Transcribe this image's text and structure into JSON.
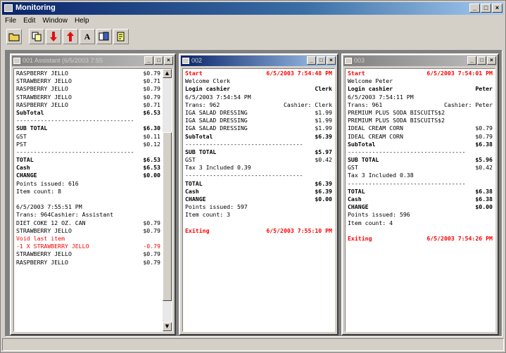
{
  "app": {
    "title": "Monitoring",
    "min": "_",
    "max": "□",
    "close": "×"
  },
  "menu": [
    "File",
    "Edit",
    "Window",
    "Help"
  ],
  "toolbar": [
    {
      "name": "open-folder-icon",
      "glyph": "▭"
    },
    {
      "name": "copy-icon",
      "glyph": "❐"
    },
    {
      "name": "arrow-down-icon",
      "glyph": "↓"
    },
    {
      "name": "arrow-up-icon",
      "glyph": "↑"
    },
    {
      "name": "font-icon",
      "glyph": "A"
    },
    {
      "name": "documents-icon",
      "glyph": "▤"
    },
    {
      "name": "help-icon",
      "glyph": "⎍"
    }
  ],
  "windows": [
    {
      "title": "001 Assistant (6/5/2003 7:55",
      "lines": [
        {
          "l": "RASPBERRY JELLO",
          "r": "$0.79"
        },
        {
          "l": "STRAWBERRY JELLO",
          "r": "$0.71"
        },
        {
          "l": "RASPBERRY JELLO",
          "r": "$0.79"
        },
        {
          "l": "STRAWBERRY JELLO",
          "r": "$0.79"
        },
        {
          "l": "RASPBERRY JELLO",
          "r": "$0.71"
        },
        {
          "l": "SubTotal",
          "r": "$6.53",
          "s": "bold"
        },
        {
          "l": "----------------------------------",
          "r": ""
        },
        {
          "l": "SUB TOTAL",
          "r": "$6.30",
          "s": "bold"
        },
        {
          "l": "GST",
          "r": "$0.11"
        },
        {
          "l": "PST",
          "r": "$0.12"
        },
        {
          "l": "----------------------------------",
          "r": ""
        },
        {
          "l": "TOTAL",
          "r": "$6.53",
          "s": "bold"
        },
        {
          "l": "Cash",
          "r": "$6.53",
          "s": "bold"
        },
        {
          "l": "CHANGE",
          "r": "$0.00",
          "s": "bold"
        },
        {
          "l": "Points issued: 616",
          "r": ""
        },
        {
          "l": "Item count: 8",
          "r": ""
        },
        {
          "l": "",
          "r": ""
        },
        {
          "l": "6/5/2003 7:55:51 PM",
          "r": ""
        },
        {
          "l": "Trans: 964Cashier: Assistant",
          "r": ""
        },
        {
          "l": "DIET COKE 12 OZ. CAN",
          "r": "$0.79"
        },
        {
          "l": "STRAWBERRY JELLO",
          "r": "$0.79"
        },
        {
          "l": "Void last item",
          "r": "",
          "s": "redplain"
        },
        {
          "l": "-1 X STRAWBERRY JELLO",
          "r": "-0.79",
          "s": "redplain"
        },
        {
          "l": "STRAWBERRY JELLO",
          "r": "$0.79"
        },
        {
          "l": "RASPBERRY JELLO",
          "r": "$0.79"
        }
      ]
    },
    {
      "title": "002",
      "lines": [
        {
          "l": "Start",
          "r": "6/5/2003 7:54:48 PM",
          "s": "red"
        },
        {
          "l": "Welcome Clerk",
          "r": ""
        },
        {
          "l": "Login cashier",
          "r": "Clerk",
          "s": "bold"
        },
        {
          "l": "6/5/2003 7:54:54 PM",
          "r": ""
        },
        {
          "l": "Trans: 962",
          "r": "Cashier: Clerk"
        },
        {
          "l": "IGA SALAD DRESSING",
          "r": "$1.99"
        },
        {
          "l": "IGA SALAD DRESSING",
          "r": "$1.99"
        },
        {
          "l": "IGA SALAD DRESSING",
          "r": "$1.99"
        },
        {
          "l": "SubTotal",
          "r": "$6.39",
          "s": "bold"
        },
        {
          "l": "----------------------------------",
          "r": ""
        },
        {
          "l": "SUB TOTAL",
          "r": "$5.97",
          "s": "bold"
        },
        {
          "l": "GST",
          "r": "$0.42"
        },
        {
          "l": "Tax 3 Included 0.39",
          "r": ""
        },
        {
          "l": "----------------------------------",
          "r": ""
        },
        {
          "l": "TOTAL",
          "r": "$6.39",
          "s": "bold"
        },
        {
          "l": "Cash",
          "r": "$6.39",
          "s": "bold"
        },
        {
          "l": "CHANGE",
          "r": "$0.00",
          "s": "bold"
        },
        {
          "l": "Points issued: 597",
          "r": ""
        },
        {
          "l": "Item count: 3",
          "r": ""
        },
        {
          "l": "",
          "r": ""
        },
        {
          "l": "Exiting",
          "r": "6/5/2003 7:55:10 PM",
          "s": "red"
        }
      ]
    },
    {
      "title": "003",
      "lines": [
        {
          "l": "Start",
          "r": "6/5/2003 7:54:01 PM",
          "s": "red"
        },
        {
          "l": "Welcome Peter",
          "r": ""
        },
        {
          "l": "Login cashier",
          "r": "Peter",
          "s": "bold"
        },
        {
          "l": "6/5/2003 7:54:11 PM",
          "r": ""
        },
        {
          "l": "Trans: 961",
          "r": "Cashier: Peter"
        },
        {
          "l": "PREMIUM PLUS SODA BISCUITS$2",
          "r": ""
        },
        {
          "l": "PREMIUM PLUS SODA BISCUITS$2",
          "r": ""
        },
        {
          "l": "IDEAL CREAM CORN",
          "r": "$0.79"
        },
        {
          "l": "IDEAL CREAM CORN",
          "r": "$0.79"
        },
        {
          "l": "SubTotal",
          "r": "$6.38",
          "s": "bold"
        },
        {
          "l": "----------------------------------",
          "r": ""
        },
        {
          "l": "SUB TOTAL",
          "r": "$5.96",
          "s": "bold"
        },
        {
          "l": "GST",
          "r": "$0.42"
        },
        {
          "l": "Tax 3 Included 0.38",
          "r": ""
        },
        {
          "l": "----------------------------------",
          "r": ""
        },
        {
          "l": "TOTAL",
          "r": "$6.38",
          "s": "bold"
        },
        {
          "l": "Cash",
          "r": "$6.38",
          "s": "bold"
        },
        {
          "l": "CHANGE",
          "r": "$0.00",
          "s": "bold"
        },
        {
          "l": "Points issued: 596",
          "r": ""
        },
        {
          "l": "Item count: 4",
          "r": ""
        },
        {
          "l": "",
          "r": ""
        },
        {
          "l": "Exiting",
          "r": "6/5/2003 7:54:26 PM",
          "s": "red"
        }
      ]
    }
  ]
}
